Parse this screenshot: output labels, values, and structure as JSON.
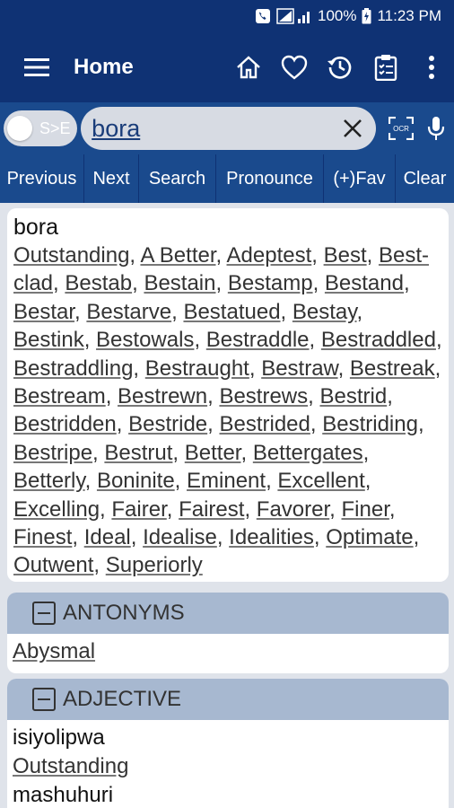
{
  "status": {
    "battery": "100%",
    "time": "11:23 PM"
  },
  "appbar": {
    "title": "Home",
    "icons": [
      "menu-icon",
      "home-icon",
      "heart-icon",
      "history-icon",
      "clipboard-icon",
      "more-vert-icon"
    ]
  },
  "search": {
    "toggle_label": "S>E",
    "value": "bora"
  },
  "buttons": [
    "Previous",
    "Next",
    "Search",
    "Pronounce",
    "(+)Fav",
    "Clear"
  ],
  "result": {
    "word": "bora",
    "synonyms": [
      "Outstanding",
      "A Better",
      "Adeptest",
      "Best",
      "Best-clad",
      "Bestab",
      "Bestain",
      "Bestamp",
      "Bestand",
      "Bestar",
      "Bestarve",
      "Bestatued",
      "Bestay",
      "Bestink",
      "Bestowals",
      "Bestraddle",
      "Bestraddled",
      "Bestraddling",
      "Bestraught",
      "Bestraw",
      "Bestreak",
      "Bestream",
      "Bestrewn",
      "Bestrews",
      "Bestrid",
      "Bestridden",
      "Bestride",
      "Bestrided",
      "Bestriding",
      "Bestripe",
      "Bestrut",
      "Better",
      "Bettergates",
      "Betterly",
      "Boninite",
      "Eminent",
      "Excellent",
      "Excelling",
      "Fairer",
      "Fairest",
      "Favorer",
      "Finer",
      "Finest",
      "Ideal",
      "Idealise",
      "Idealities",
      "Optimate",
      "Outwent",
      "Superiorly"
    ]
  },
  "antonyms": {
    "header": "ANTONYMS",
    "items": [
      "Abysmal"
    ]
  },
  "adjective": {
    "header": "ADJECTIVE",
    "entries": [
      {
        "word": "isiyolipwa",
        "link": "Outstanding"
      },
      {
        "word": "mashuhuri"
      }
    ]
  }
}
